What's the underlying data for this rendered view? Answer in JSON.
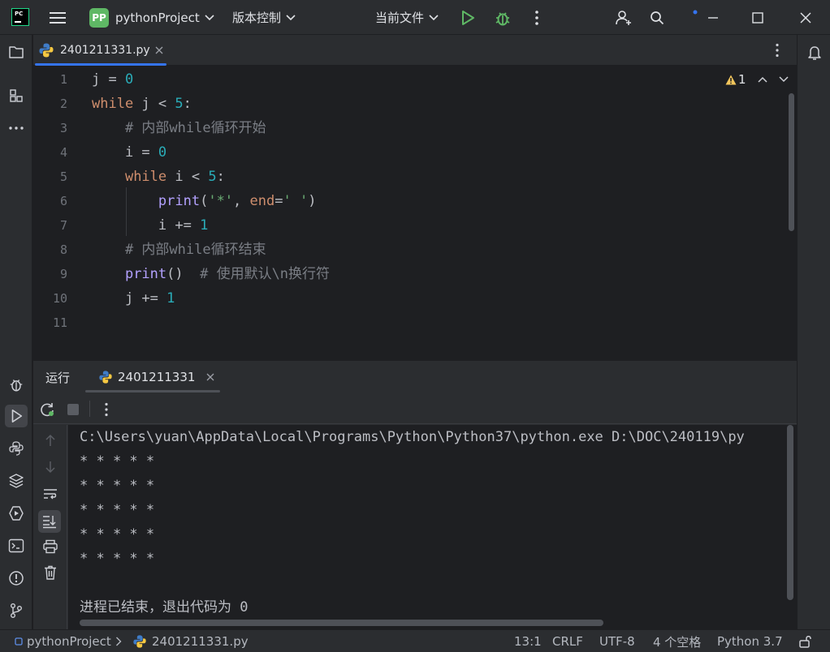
{
  "titlebar": {
    "logo_text": "PC",
    "project_badge": "PP",
    "project_name": "pythonProject",
    "vcs_label": "版本控制",
    "run_config": "当前文件"
  },
  "editor": {
    "tab": {
      "filename": "2401211331.py"
    },
    "warning_count": "1",
    "lines": [
      {
        "num": "1",
        "tokens": [
          {
            "t": "j = ",
            "c": ""
          },
          {
            "t": "0",
            "c": "num"
          }
        ]
      },
      {
        "num": "2",
        "tokens": [
          {
            "t": "while",
            "c": "kw"
          },
          {
            "t": " j < ",
            "c": ""
          },
          {
            "t": "5",
            "c": "num"
          },
          {
            "t": ":",
            "c": ""
          }
        ]
      },
      {
        "num": "3",
        "tokens": [
          {
            "t": "    # 内部while循环开始",
            "c": "cm"
          }
        ]
      },
      {
        "num": "4",
        "tokens": [
          {
            "t": "    i = ",
            "c": ""
          },
          {
            "t": "0",
            "c": "num"
          }
        ]
      },
      {
        "num": "5",
        "tokens": [
          {
            "t": "    ",
            "c": ""
          },
          {
            "t": "while",
            "c": "kw"
          },
          {
            "t": " i < ",
            "c": ""
          },
          {
            "t": "5",
            "c": "num"
          },
          {
            "t": ":",
            "c": ""
          }
        ]
      },
      {
        "num": "6",
        "tokens": [
          {
            "t": "        ",
            "c": ""
          },
          {
            "t": "print",
            "c": "fn"
          },
          {
            "t": "(",
            "c": ""
          },
          {
            "t": "'*'",
            "c": "str"
          },
          {
            "t": ", ",
            "c": ""
          },
          {
            "t": "end",
            "c": "param"
          },
          {
            "t": "=",
            "c": ""
          },
          {
            "t": "' '",
            "c": "str"
          },
          {
            "t": ")",
            "c": ""
          }
        ]
      },
      {
        "num": "7",
        "tokens": [
          {
            "t": "        i += ",
            "c": ""
          },
          {
            "t": "1",
            "c": "num"
          }
        ]
      },
      {
        "num": "8",
        "tokens": [
          {
            "t": "    # 内部while循环结束",
            "c": "cm"
          }
        ]
      },
      {
        "num": "9",
        "tokens": [
          {
            "t": "    ",
            "c": ""
          },
          {
            "t": "print",
            "c": "fn"
          },
          {
            "t": "()  ",
            "c": ""
          },
          {
            "t": "# 使用默认\\n换行符",
            "c": "cm"
          }
        ]
      },
      {
        "num": "10",
        "tokens": [
          {
            "t": "    j += ",
            "c": ""
          },
          {
            "t": "1",
            "c": "num"
          }
        ]
      },
      {
        "num": "11",
        "tokens": [
          {
            "t": "",
            "c": ""
          }
        ]
      }
    ]
  },
  "run": {
    "panel_label": "运行",
    "tab_label": "2401211331",
    "console_lines": [
      "C:\\Users\\yuan\\AppData\\Local\\Programs\\Python\\Python37\\python.exe D:\\DOC\\240119\\py",
      "* * * * *",
      "* * * * *",
      "* * * * *",
      "* * * * *",
      "* * * * *",
      "",
      "进程已结束，退出代码为 0"
    ]
  },
  "statusbar": {
    "project": "pythonProject",
    "file": "2401211331.py",
    "position": "13:1",
    "line_ending": "CRLF",
    "encoding": "UTF-8",
    "indent": "4 个空格",
    "interpreter": "Python 3.7"
  },
  "colors": {
    "background": "#1e1f22",
    "panel": "#2b2d30",
    "accent": "#3574f0",
    "run_green": "#5fb865",
    "keyword": "#cf8e6d",
    "number": "#2aacb8",
    "string": "#6aab73",
    "function": "#b3a1ff",
    "comment": "#7a7e85"
  }
}
